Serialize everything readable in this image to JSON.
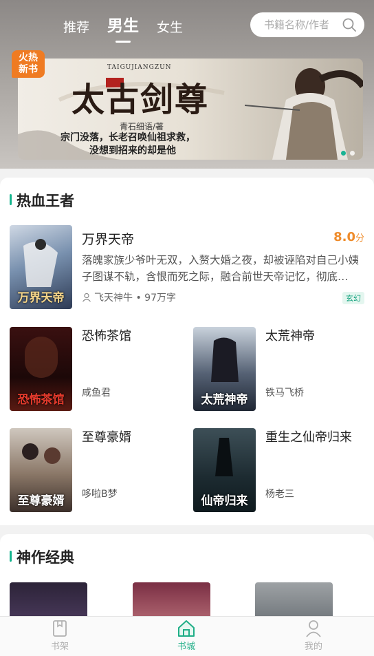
{
  "header": {
    "tabs": [
      {
        "label": "推荐",
        "active": false
      },
      {
        "label": "男生",
        "active": true
      },
      {
        "label": "女生",
        "active": false
      }
    ],
    "search_placeholder": "书籍名称/作者"
  },
  "banner": {
    "badge": "火热\n新书",
    "latin": "TAIGUJIANGZUN",
    "title": "太古剑尊",
    "author": "青石细语/著",
    "tagline_1": "宗门没落，长老召唤仙祖求救，",
    "tagline_2": "没想到招来的却是他",
    "page_count": 2,
    "active_page": 0
  },
  "section_hot": {
    "title": "热血王者",
    "featured": {
      "title": "万界天帝",
      "cover_text": "万界天帝",
      "score": "8.0",
      "score_unit": "分",
      "description": "落魄家族少爷叶无双，入赘大婚之夜，却被诬陷对自己小姨子图谋不轨，含恨而死之际，融合前世天帝记忆，彻底…",
      "meta": "飞天神牛 • 97万字",
      "genre": "玄幻"
    },
    "books": [
      {
        "title": "恐怖茶馆",
        "author": "咸鱼君",
        "cover_text": "恐怖茶馆"
      },
      {
        "title": "太荒神帝",
        "author": "铁马飞桥",
        "cover_text": "太荒神帝"
      },
      {
        "title": "至尊豪婿",
        "author": "哆啦B梦",
        "cover_text": "至尊豪婿"
      },
      {
        "title": "重生之仙帝归来",
        "author": "杨老三",
        "cover_text": "仙帝归来"
      }
    ]
  },
  "section_classic": {
    "title": "神作经典"
  },
  "nav": {
    "items": [
      {
        "label": "书架",
        "icon": "bookshelf-icon",
        "active": false
      },
      {
        "label": "书城",
        "icon": "home-icon",
        "active": true
      },
      {
        "label": "我的",
        "icon": "user-icon",
        "active": false
      }
    ]
  },
  "colors": {
    "accent": "#1fae87",
    "score": "#ef8c2b",
    "badge": "#ef7b22"
  }
}
